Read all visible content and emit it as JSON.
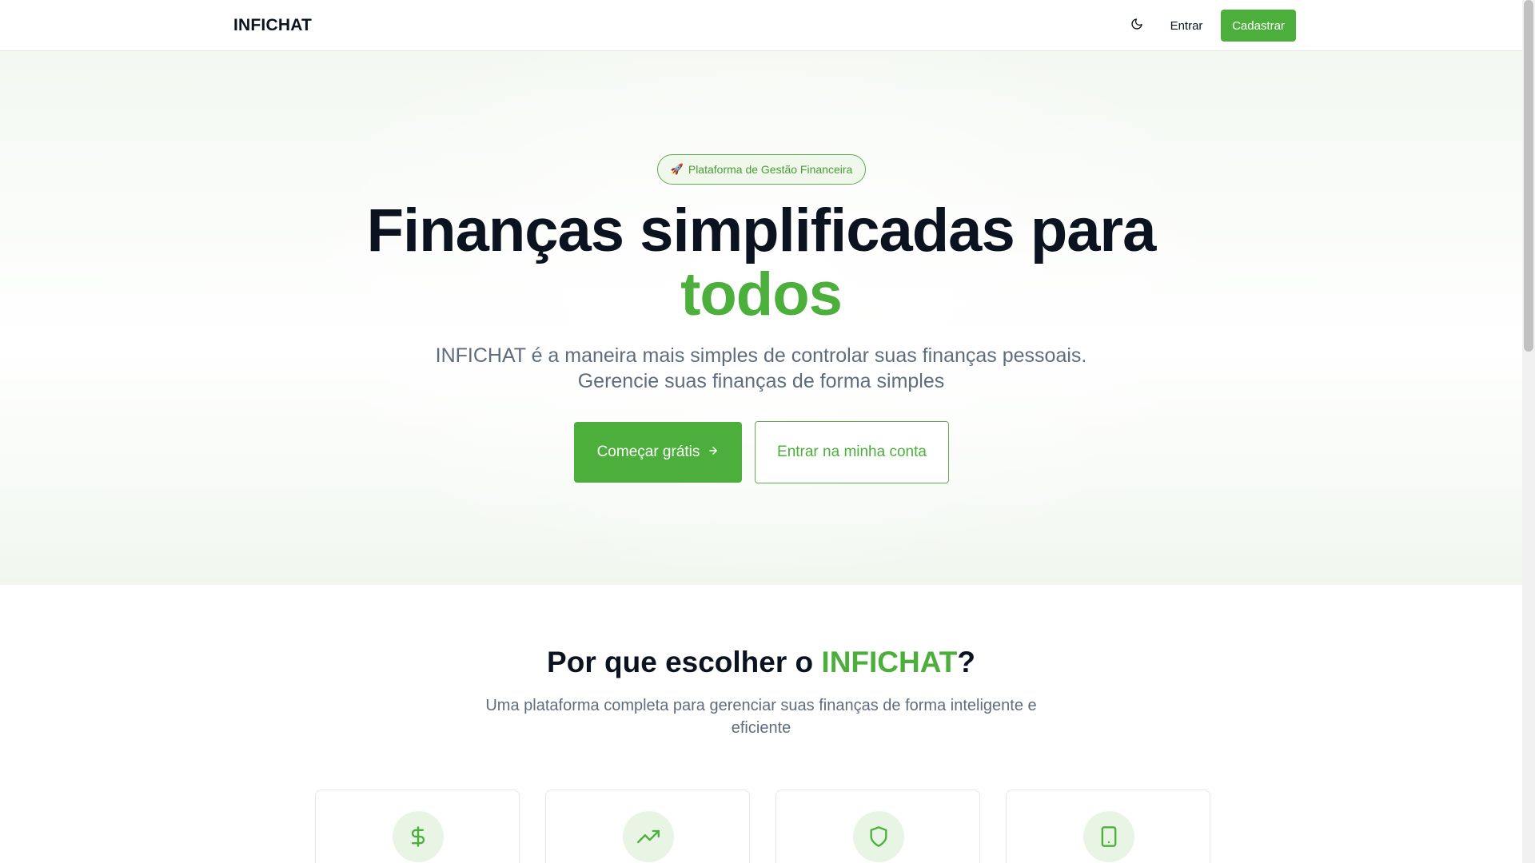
{
  "header": {
    "logo": "INFICHAT",
    "theme_icon": "moon-icon",
    "login_label": "Entrar",
    "signup_label": "Cadastrar"
  },
  "hero": {
    "badge_icon": "rocket-icon",
    "badge_emoji": "🚀",
    "badge_label": "Plataforma de Gestão Financeira",
    "title_main": "Finanças simplificadas para",
    "title_accent": "todos",
    "subtitle": "INFICHAT é a maneira mais simples de controlar suas finanças pessoais. Gerencie suas finanças de forma simples",
    "primary_cta": "Começar grátis",
    "primary_cta_icon": "arrow-right-icon",
    "secondary_cta": "Entrar na minha conta"
  },
  "features": {
    "title_prefix": "Por que escolher o ",
    "title_accent": "INFICHAT",
    "title_suffix": "?",
    "subtitle": "Uma plataforma completa para gerenciar suas finanças de forma inteligente e eficiente",
    "cards": [
      {
        "icon": "dollar-sign-icon"
      },
      {
        "icon": "trending-up-icon"
      },
      {
        "icon": "shield-icon"
      },
      {
        "icon": "smartphone-icon"
      }
    ]
  },
  "colors": {
    "accent": "#4caf3c",
    "text": "#0b1220",
    "muted": "#5f6c80",
    "icon_bg": "#e8f4e4"
  }
}
